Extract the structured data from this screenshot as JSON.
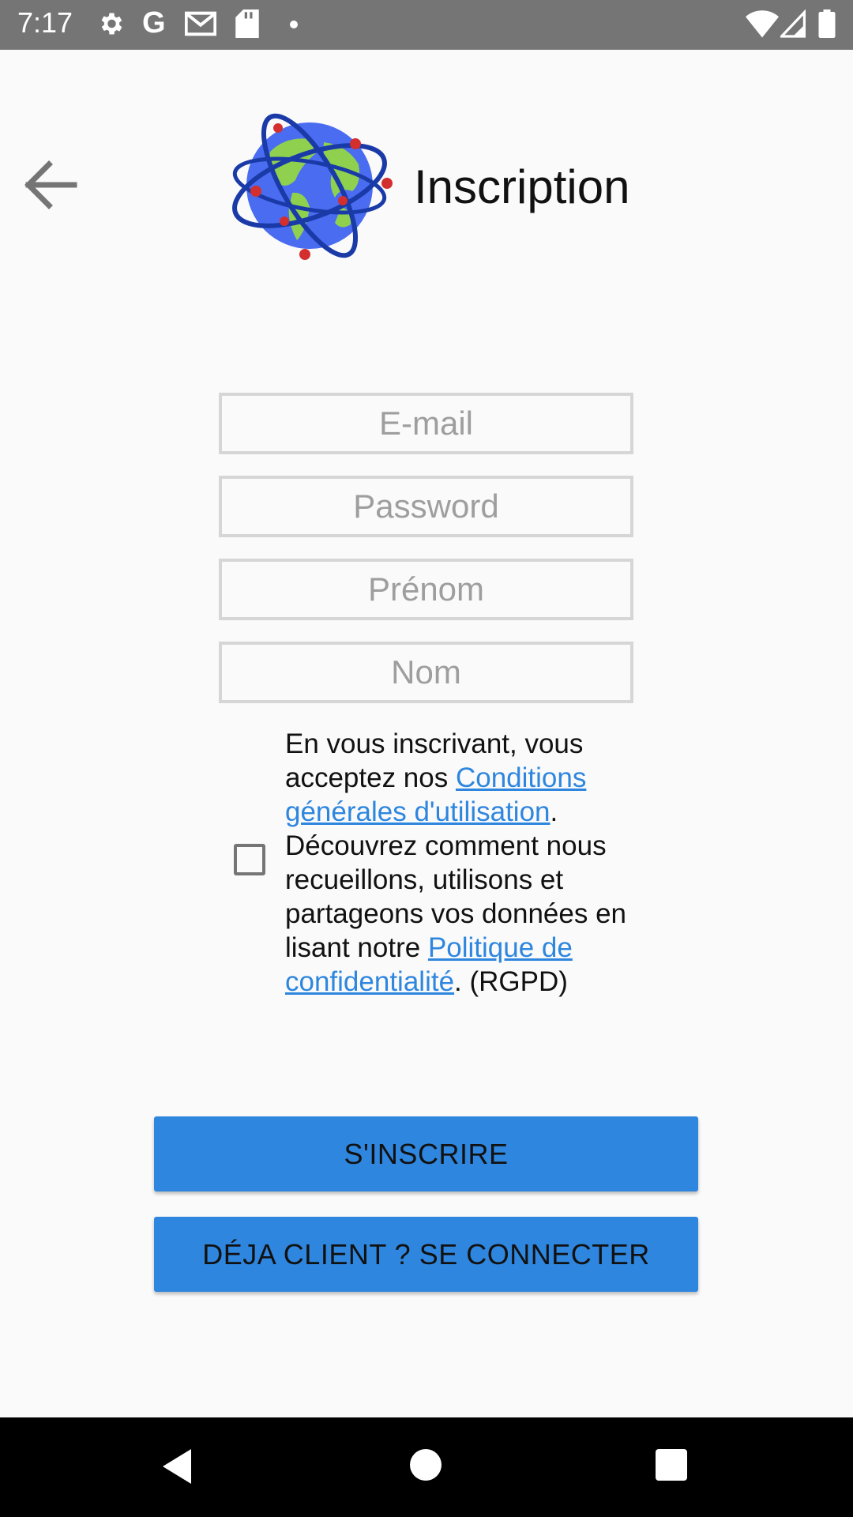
{
  "status_bar": {
    "time": "7:17",
    "left_icons": [
      "gear-icon",
      "google-icon",
      "gmail-icon",
      "sd-card-icon",
      "dot-icon"
    ],
    "right_icons": [
      "wifi-icon",
      "signal-icon",
      "battery-icon"
    ]
  },
  "header": {
    "title": "Inscription",
    "back_icon": "arrow-left-icon",
    "logo_icon": "globe-network-icon"
  },
  "form": {
    "email_placeholder": "E-mail",
    "password_placeholder": "Password",
    "firstname_placeholder": "Prénom",
    "lastname_placeholder": "Nom",
    "email_value": "",
    "password_value": "",
    "firstname_value": "",
    "lastname_value": ""
  },
  "consent": {
    "checked": false,
    "text_1": "En vous inscrivant, vous acceptez nos ",
    "link_terms": "Conditions générales d'utilisation",
    "text_2": ". Découvrez comment nous recueillons, utilisons et partageons vos données en lisant notre ",
    "link_privacy": "Politique de confidentialité",
    "text_3": ". (RGPD)"
  },
  "buttons": {
    "signup_label": "S'INSCRIRE",
    "login_label": "DÉJA CLIENT ? SE CONNECTER"
  },
  "colors": {
    "accent": "#2F86DE",
    "status_bar": "#757575",
    "background": "#FAFAFA",
    "link": "#2E86DE"
  }
}
